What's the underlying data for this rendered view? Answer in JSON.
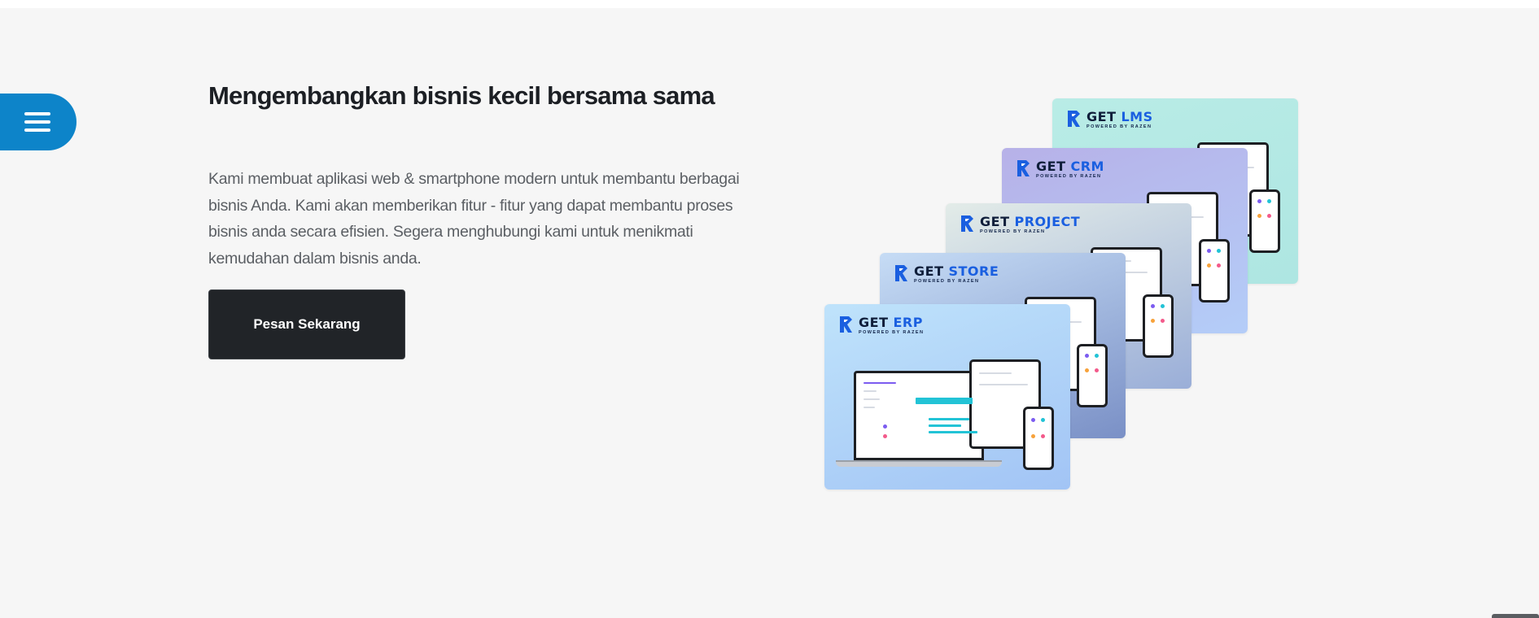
{
  "hero": {
    "headline": "Mengembangkan bisnis kecil bersama sama",
    "description": "Kami membuat aplikasi web & smartphone modern untuk membantu berbagai bisnis Anda. Kami akan memberikan fitur - fitur yang dapat membantu proses bisnis anda secara efisien. Segera menghubungi kami untuk menikmati kemudahan dalam bisnis anda.",
    "cta_label": "Pesan Sekarang"
  },
  "menu": {
    "icon": "hamburger-menu-icon"
  },
  "products": [
    {
      "word1": "GET",
      "word2": "LMS",
      "powered_by": "POWERED BY RAZEN",
      "colors": [
        "#b9ece6",
        "#aee6e2"
      ]
    },
    {
      "word1": "GET",
      "word2": "CRM",
      "powered_by": "POWERED BY RAZEN",
      "colors": [
        "#b7b1e8",
        "#b4cdf8"
      ]
    },
    {
      "word1": "GET",
      "word2": "PROJECT",
      "powered_by": "POWERED BY RAZEN",
      "colors": [
        "#e3ece8",
        "#9aaed8"
      ]
    },
    {
      "word1": "GET",
      "word2": "STORE",
      "powered_by": "POWERED BY RAZEN",
      "colors": [
        "#c6dcf5",
        "#7a90c6"
      ]
    },
    {
      "word1": "GET",
      "word2": "ERP",
      "powered_by": "POWERED BY RAZEN",
      "colors": [
        "#bfe3fb",
        "#a2c4f5"
      ]
    }
  ],
  "colors": {
    "accent": "#0d84c9",
    "cta_background": "#212428",
    "brand_blue": "#1a5fe0",
    "page_background": "#f6f6f6"
  }
}
